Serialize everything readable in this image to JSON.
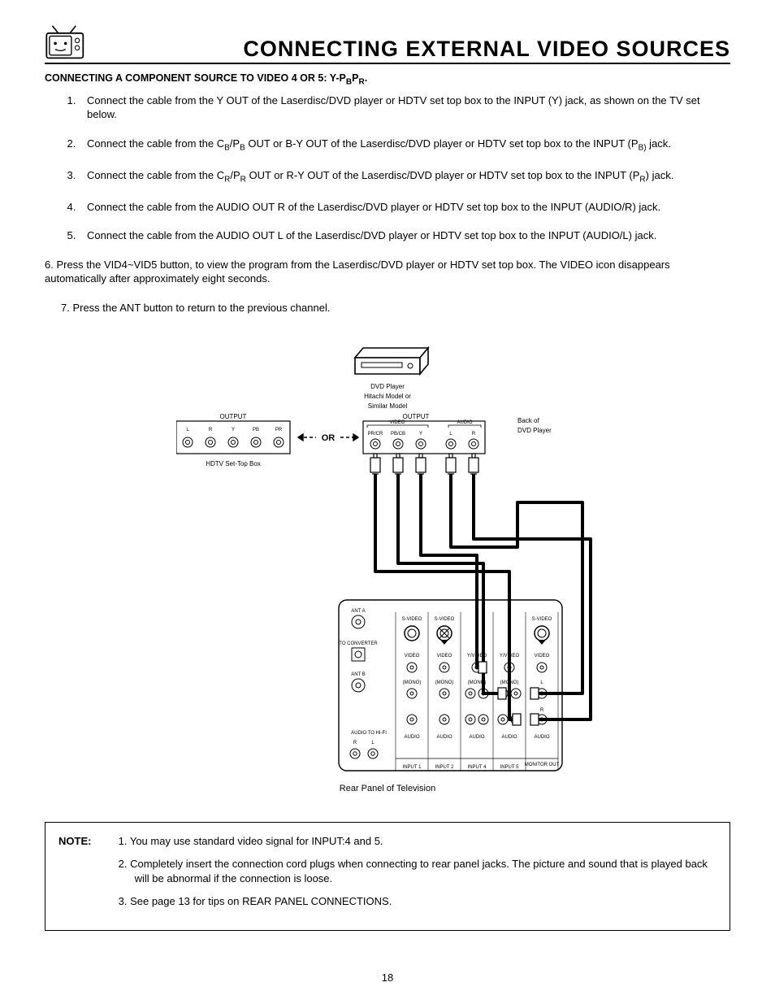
{
  "title": "CONNECTING EXTERNAL VIDEO SOURCES",
  "section_head_prefix": "CONNECTING A COMPONENT SOURCE TO VIDEO 4 OR 5:  Y-P",
  "section_head_sub1": "B",
  "section_head_mid": "P",
  "section_head_sub2": "R",
  "section_head_suffix": ".",
  "steps": {
    "s1": "Connect the cable from the Y OUT of the Laserdisc/DVD player or HDTV set top box to the INPUT (Y) jack, as shown on the TV set below.",
    "s2a": "Connect the cable from the C",
    "s2b": "B",
    "s2c": "/P",
    "s2d": "B",
    "s2e": " OUT or B-Y OUT of the Laserdisc/DVD player or HDTV set top box to the INPUT (P",
    "s2f": "B)",
    "s2g": " jack.",
    "s3a": "Connect the cable from the C",
    "s3b": "R",
    "s3c": "/P",
    "s3d": "R",
    "s3e": " OUT or R-Y OUT of the Laserdisc/DVD player or HDTV set top box to the INPUT (P",
    "s3f": "R",
    "s3g": ") jack.",
    "s4": "Connect the cable from the AUDIO OUT R of the Laserdisc/DVD player or HDTV set top box to the INPUT (AUDIO/R) jack.",
    "s5": "Connect the cable from the AUDIO OUT L of the Laserdisc/DVD player or HDTV set top box to the INPUT (AUDIO/L) jack.",
    "s6": "6.      Press the VID4~VID5 button, to view the program from the Laserdisc/DVD player or HDTV set top box.  The VIDEO icon disappears automatically after approximately eight seconds.",
    "s7": "7.      Press the ANT button to return to the previous channel."
  },
  "diagram": {
    "dvd_line1": "DVD Player",
    "dvd_line2": "Hitachi Model or",
    "dvd_line3": "Similar Model",
    "output": "OUTPUT",
    "or": "OR",
    "hdtv_box": "HDTV Set-Top Box",
    "back_of": "Back of",
    "back_of2": "DVD Player",
    "video": "VIDEO",
    "audio": "AUDIO",
    "L": "L",
    "R": "R",
    "Y": "Y",
    "PB": "PB",
    "PR": "PR",
    "PRCR": "PR/CR",
    "PBCB": "PB/CB",
    "rear_caption": "Rear Panel of Television",
    "ant_a": "ANT A",
    "ant_b": "ANT B",
    "to_conv": "TO\nCONVERTER",
    "audio_hifi": "AUDIO TO HI-FI",
    "svideo": "S-VIDEO",
    "yvideo": "Y/VIDEO",
    "vid": "VIDEO",
    "mono": "(MONO)",
    "aud": "AUDIO",
    "in1": "INPUT 1",
    "in2": "INPUT 2",
    "in4": "INPUT 4",
    "in5": "INPUT 5",
    "mon": "MONITOR\nOUT"
  },
  "note": {
    "label": "NOTE:",
    "n1": "1.  You may use standard video signal for INPUT:4 and 5.",
    "n2": "2.  Completely insert the connection cord plugs when connecting to rear panel jacks.  The picture and sound that is played back will be abnormal if the connection is loose.",
    "n3": "3.  See page 13 for tips on REAR PANEL CONNECTIONS."
  },
  "page_number": "18"
}
